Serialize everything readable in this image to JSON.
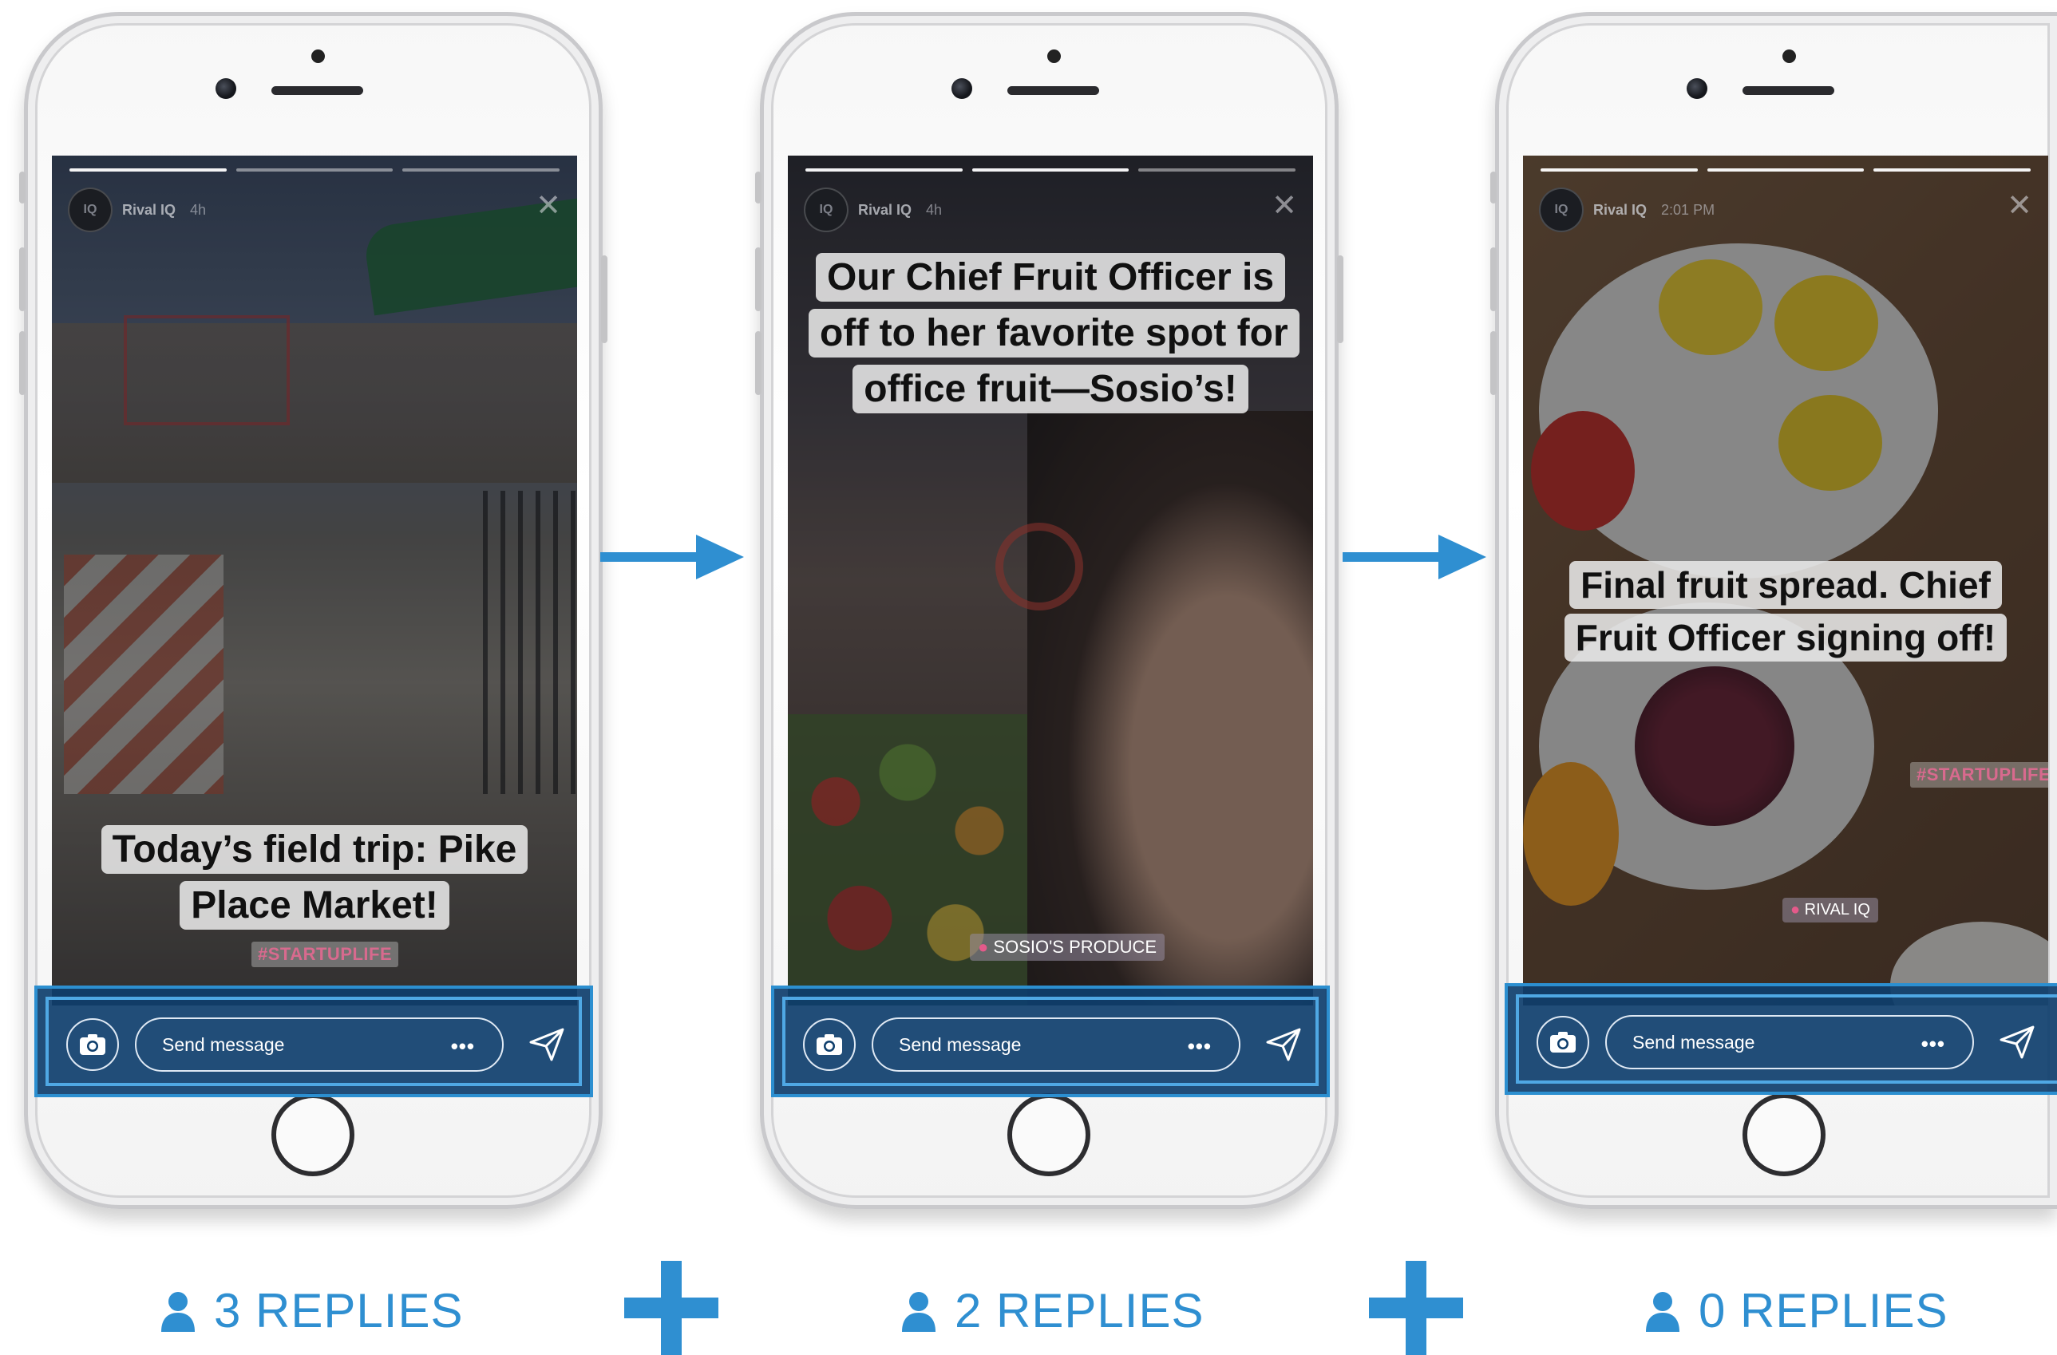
{
  "colors": {
    "accent": "#2f8fd1",
    "reply_bar_bg": "#0e3e6c",
    "caption_bg": "#e8e8e8"
  },
  "stories": [
    {
      "account": "Rival IQ",
      "time": "4h",
      "caption": "Today’s field trip: Pike Place Market!",
      "hashtag": "#STARTUPLIFE",
      "location": "",
      "message_placeholder": "Send message",
      "replies": "3 REPLIES"
    },
    {
      "account": "Rival IQ",
      "time": "4h",
      "caption": "Our Chief Fruit Officer is off to her favorite spot for office fruit—Sosio’s!",
      "hashtag": "",
      "location": "SOSIO'S PRODUCE",
      "message_placeholder": "Send message",
      "replies": "2 REPLIES"
    },
    {
      "account": "Rival IQ",
      "time": "2:01 PM",
      "caption": "Final fruit spread. Chief Fruit Officer signing off!",
      "hashtag": "#STARTUPLIFE",
      "location": "RIVAL IQ",
      "message_placeholder": "Send message",
      "replies": "0 REPLIES"
    }
  ],
  "icons": {
    "camera": "camera-icon",
    "more": "more-dots-icon",
    "send": "paper-plane-send-icon",
    "close": "close-icon",
    "person": "person-icon",
    "arrow": "arrow-right-icon",
    "plus": "plus-icon"
  },
  "symbols": {
    "more": "•••",
    "close": "✕",
    "avatar": "IQ"
  }
}
